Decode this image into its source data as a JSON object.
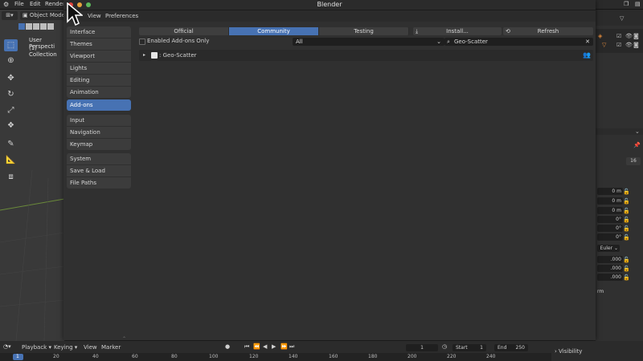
{
  "topbar": {
    "menu": [
      "File",
      "Edit",
      "Render"
    ]
  },
  "viewport": {
    "mode": "Object Mode",
    "overlay_line1": "User Perspecti",
    "overlay_line2": "(1) Collection"
  },
  "prefs": {
    "title": "Blender",
    "menu": [
      "View",
      "Preferences"
    ],
    "categories_group1": [
      "Interface",
      "Themes",
      "Viewport",
      "Lights",
      "Editing",
      "Animation"
    ],
    "categories_group2": [
      "Add-ons"
    ],
    "categories_group3": [
      "Input",
      "Navigation",
      "Keymap"
    ],
    "categories_group4": [
      "System",
      "Save & Load",
      "File Paths"
    ],
    "tabs": [
      "Official",
      "Community",
      "Testing"
    ],
    "install_label": "Install...",
    "refresh_label": "Refresh",
    "enabled_only_label": "Enabled Add-ons Only",
    "filter_value": "All",
    "search_value": "Geo-Scatter",
    "addon_label": ": Geo-Scatter",
    "colors": {
      "accent": "#4772b3",
      "close": "#e0443e",
      "minimize": "#e6a23c",
      "maximize": "#5cb85c"
    }
  },
  "rightpanel": {
    "frame_value": "16",
    "loc": [
      "0 m",
      "0 m",
      "0 m"
    ],
    "rot": [
      "0°",
      "0°",
      "0°"
    ],
    "mode": "Euler",
    "scale": [
      ".000",
      ".000",
      ".000"
    ],
    "label_rm": "rm",
    "visibility": "Visibility"
  },
  "timeline": {
    "menu": [
      "Playback",
      "Keying",
      "View",
      "Marker"
    ],
    "current_frame": "1",
    "start_label": "Start",
    "start_value": "1",
    "end_label": "End",
    "end_value": "250",
    "ruler": [
      "1",
      "20",
      "40",
      "60",
      "80",
      "100",
      "120",
      "140",
      "160",
      "180",
      "200",
      "220",
      "240"
    ]
  }
}
